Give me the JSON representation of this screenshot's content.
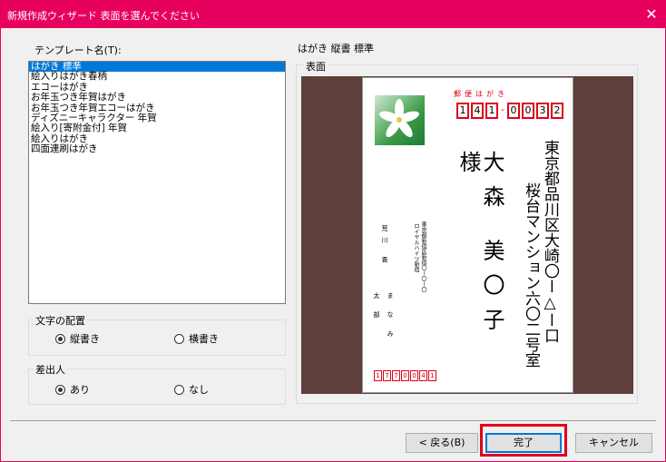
{
  "window": {
    "title": "新規作成ウィザード 表面を選んでください",
    "close_glyph": "✕"
  },
  "templates": {
    "label": "テンプレート名(T):",
    "items": [
      "はがき 標準",
      "絵入りはがき春柄",
      "エコーはがき",
      "お年玉つき年賀はがき",
      "お年玉つき年賀エコーはがき",
      "ディズニーキャラクター 年賀",
      "絵入り[寄附金付] 年賀",
      "絵入りはがき",
      "四面連刷はがき"
    ],
    "selected_index": 0
  },
  "layout_group": {
    "title": "文字の配置",
    "options": [
      "縦書き",
      "横書き"
    ],
    "selected": "縦書き"
  },
  "sender_group": {
    "title": "差出人",
    "options": [
      "あり",
      "なし"
    ],
    "selected": "あり"
  },
  "preview": {
    "caption": "はがき 縦書 標準",
    "frame_label": "表面",
    "postcard": {
      "post_label": "郵便はがき",
      "zip_top": [
        "1",
        "4",
        "1",
        "-",
        "0",
        "0",
        "3",
        "2"
      ],
      "address_line1": "東京都品川区大崎〇ー△ー口",
      "address_line2": "桜台マンション六〇二号室",
      "recipient_name": "大森 美〇子 様",
      "sender_address1": "東京都新宿区新宿〇ー〇ー〇",
      "sender_address2": "ロイヤルハイツ新宿",
      "sender_name_a": "荒川 晋",
      "sender_name_b": "鮭",
      "sender_name_c": "太部",
      "sender_name_d": "まなみ",
      "zip_bottom": [
        "1",
        "7",
        "7",
        "0",
        "0",
        "4",
        "1"
      ]
    }
  },
  "buttons": {
    "back": "< 戻る(B)",
    "finish": "完了",
    "cancel": "キャンセル"
  },
  "colors": {
    "titlebar": "#e8005f",
    "selection": "#0078d7",
    "highlight_box": "#e0001b"
  }
}
